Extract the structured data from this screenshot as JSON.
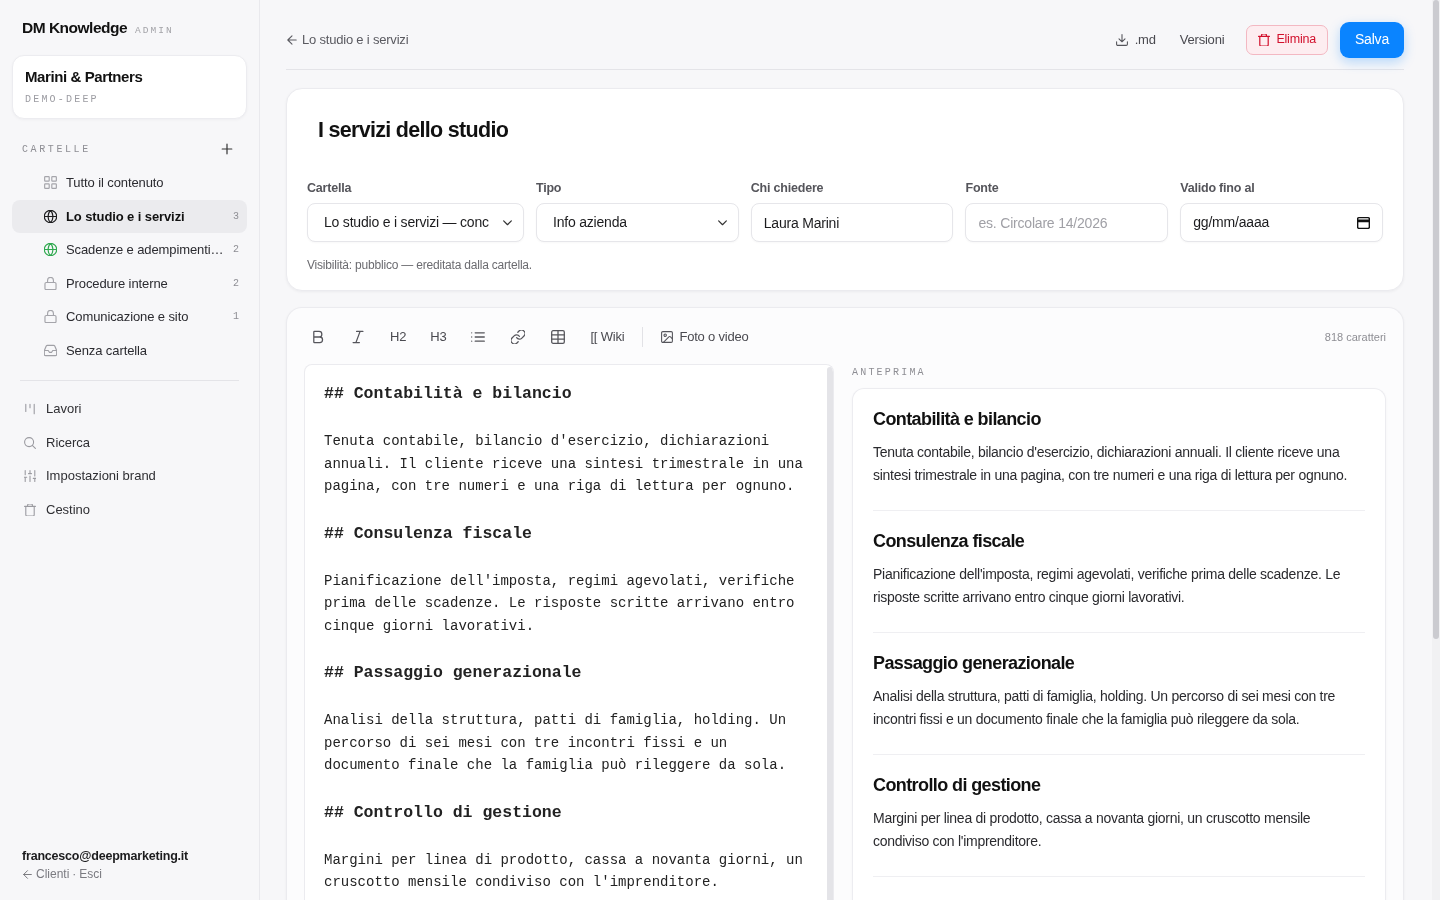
{
  "sidebar": {
    "brand": {
      "name": "DM Knowledge",
      "badge": "ADMIN"
    },
    "account": {
      "name": "Marini & Partners",
      "code": "DEMO-DEEP"
    },
    "folders_label": "CARTELLE",
    "folders": [
      {
        "label": "Tutto il contenuto",
        "selected": false
      },
      {
        "label": "Lo studio e i servizi",
        "count": "3",
        "selected": true
      },
      {
        "label": "Scadenze e adempimenti…",
        "count": "2",
        "selected": false
      },
      {
        "label": "Procedure interne",
        "count": "2",
        "selected": false
      },
      {
        "label": "Comunicazione e sito",
        "count": "1",
        "selected": false
      },
      {
        "label": "Senza cartella",
        "selected": false
      }
    ],
    "nav": [
      "Lavori",
      "Ricerca",
      "Impostazioni brand",
      "Cestino"
    ],
    "footer": {
      "email": "francesco@deepmarketing.it",
      "links": [
        "Clienti",
        "Esci"
      ],
      "separator": "·"
    }
  },
  "topbar": {
    "back": "Lo studio e i servizi",
    "actions": [
      {
        "kind": "download",
        "label": ".md"
      },
      {
        "kind": "link",
        "label": "Versioni"
      },
      {
        "kind": "danger",
        "label": "Elimina"
      },
      {
        "kind": "primary",
        "label": "Salva"
      }
    ]
  },
  "document": {
    "title": "I servizi dello studio",
    "fields": [
      {
        "kind": "select",
        "label": "Cartella",
        "value": "Lo studio e i servizi — conc"
      },
      {
        "kind": "select",
        "label": "Tipo",
        "value": "Info azienda"
      },
      {
        "kind": "text",
        "label": "Chi chiedere",
        "value": "Laura Marini"
      },
      {
        "kind": "text",
        "label": "Fonte",
        "placeholder": "es. Circolare 14/2026"
      },
      {
        "kind": "date",
        "label": "Valido fino al",
        "placeholder": "gg/mm/aaaa"
      }
    ],
    "visibility": "Visibilità: pubblico — ereditata dalla cartella."
  },
  "editor": {
    "toolbar": {
      "headings": [
        "H2",
        "H3"
      ],
      "wiki": "[[ Wiki",
      "media": "Foto o video"
    },
    "char_count": "818 caratteri",
    "blocks": [
      {
        "kind": "heading",
        "text": "## Contabilità e bilancio"
      },
      {
        "kind": "paragraph",
        "text": "Tenuta contabile, bilancio d'esercizio, dichiarazioni annuali. Il cliente riceve una sintesi trimestrale in una pagina, con tre numeri e una riga di lettura per ognuno."
      },
      {
        "kind": "heading",
        "text": "## Consulenza fiscale"
      },
      {
        "kind": "paragraph",
        "text": "Pianificazione dell'imposta, regimi agevolati, verifiche prima delle scadenze. Le risposte scritte arrivano entro cinque giorni lavorativi."
      },
      {
        "kind": "heading",
        "text": "## Passaggio generazionale"
      },
      {
        "kind": "paragraph",
        "text": "Analisi della struttura, patti di famiglia, holding. Un percorso di sei mesi con tre incontri fissi e un documento finale che la famiglia può rileggere da sola."
      },
      {
        "kind": "heading",
        "text": "## Controllo di gestione"
      },
      {
        "kind": "paragraph",
        "text": "Margini per linea di prodotto, cassa a novanta giorni, un cruscotto mensile condiviso con l'imprenditore."
      }
    ]
  },
  "preview": {
    "label": "ANTEPRIMA",
    "sections": [
      {
        "heading": "Contabilità e bilancio",
        "body": "Tenuta contabile, bilancio d'esercizio, dichiarazioni annuali. Il cliente riceve una sintesi trimestrale in una pagina, con tre numeri e una riga di lettura per ognuno."
      },
      {
        "heading": "Consulenza fiscale",
        "body": "Pianificazione dell'imposta, regimi agevolati, verifiche prima delle scadenze. Le risposte scritte arrivano entro cinque giorni lavorativi."
      },
      {
        "heading": "Passaggio generazionale",
        "body": "Analisi della struttura, patti di famiglia, holding. Un percorso di sei mesi con tre incontri fissi e un documento finale che la famiglia può rileggere da sola."
      },
      {
        "heading": "Controllo di gestione",
        "body": "Margini per linea di prodotto, cassa a novanta giorni, un cruscotto mensile condiviso con l'imprenditore."
      }
    ]
  }
}
